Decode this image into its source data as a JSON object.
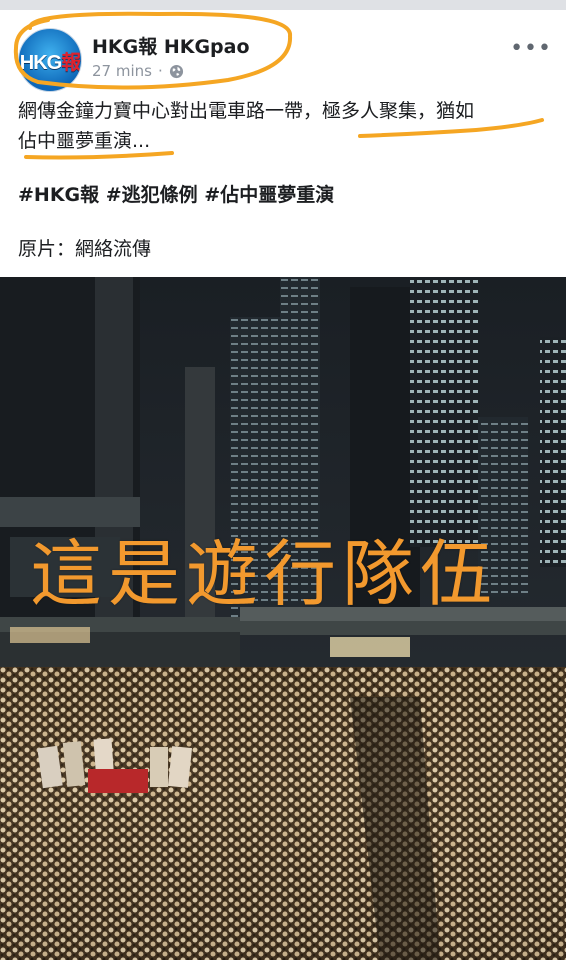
{
  "post": {
    "page_name": "HKG報 HKGpao",
    "timestamp": "27 mins",
    "separator": "·",
    "privacy_icon": "globe-icon",
    "more_icon": "more-options-icon",
    "avatar_logo_text": "HKG報",
    "body_line1": "網傳金鐘力寶中心對出電車路一帶，極多人聚集，猶如",
    "body_line2": "佔中噩夢重演...",
    "hashtags": "#HKG報 #逃犯條例 #佔中噩夢重演",
    "source": "原片：網絡流傳"
  },
  "photo": {
    "overlay_text": "這是遊行隊伍"
  },
  "colors": {
    "annotation_orange": "#f5a623",
    "overlay_text": "#f2992e",
    "meta_gray": "#8d949e"
  }
}
